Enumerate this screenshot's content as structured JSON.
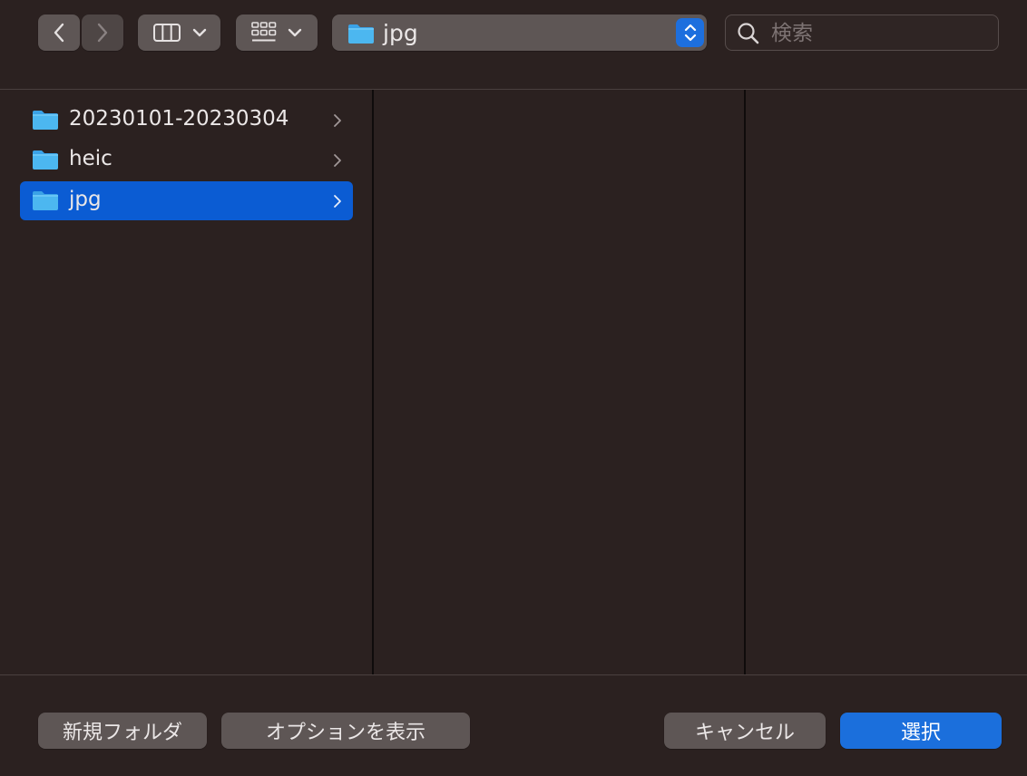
{
  "toolbar": {
    "back_icon": "chevron-left-icon",
    "forward_icon": "chevron-right-icon",
    "view_mode_icon": "columns-view-icon",
    "group_icon": "grid-group-icon",
    "path_popup_label": "jpg",
    "search_placeholder": "検索"
  },
  "browser": {
    "column_1": [
      {
        "label": "20230101-20230304",
        "icon": "folder-icon",
        "selected": false
      },
      {
        "label": "heic",
        "icon": "folder-icon",
        "selected": false
      },
      {
        "label": "jpg",
        "icon": "folder-icon",
        "selected": true
      }
    ]
  },
  "footer": {
    "new_folder_label": "新規フォルダ",
    "options_label": "オプションを表示",
    "cancel_label": "キャンセル",
    "select_label": "選択"
  },
  "colors": {
    "accent": "#0b5cd3",
    "primary_button": "#1b6fdc",
    "folder_blue": "#4cb7f0",
    "background": "#2b2120"
  }
}
